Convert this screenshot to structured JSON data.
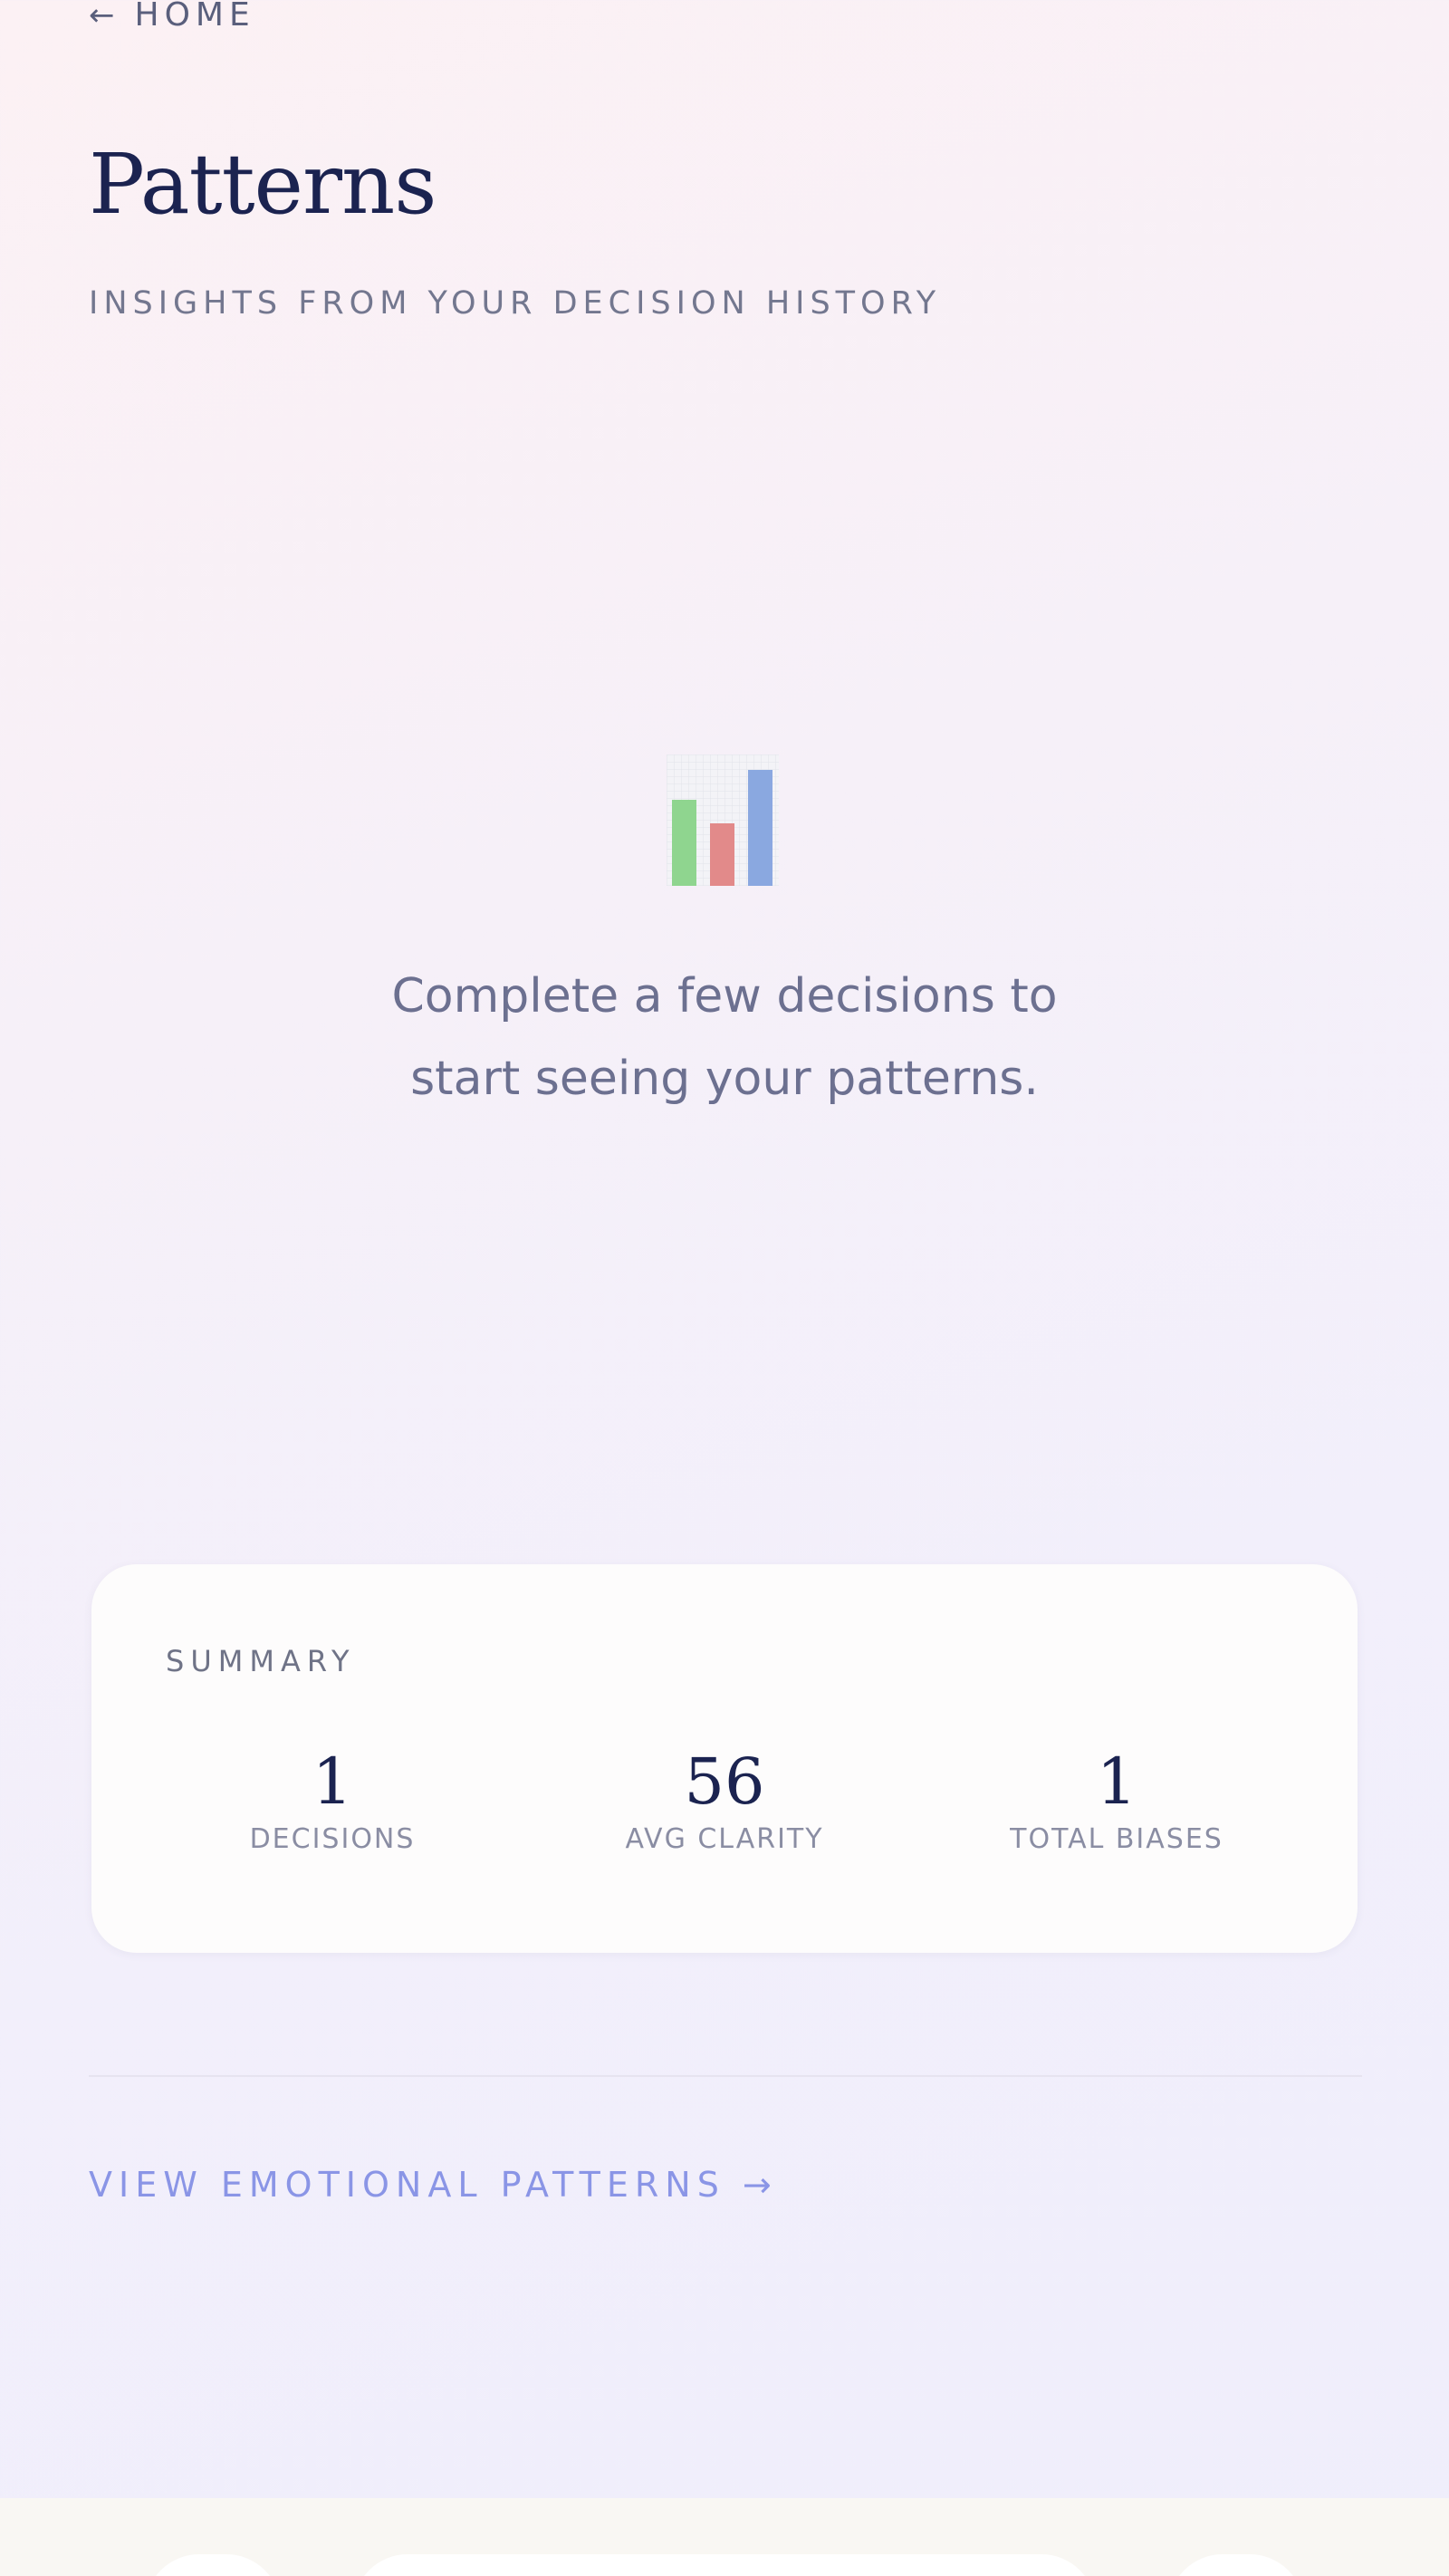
{
  "nav": {
    "back_icon": "←",
    "back_label": "HOME"
  },
  "header": {
    "title": "Patterns",
    "subtitle": "INSIGHTS FROM YOUR DECISION HISTORY"
  },
  "empty_state": {
    "icon": "bar-chart-icon",
    "icon_colors": {
      "bar1": "#8fd58f",
      "bar2": "#e28a8a",
      "bar3": "#8aa8e0"
    },
    "message_line1": "Complete a few decisions to",
    "message_line2": "start seeing your patterns."
  },
  "summary": {
    "label": "SUMMARY",
    "stats": [
      {
        "value": "1",
        "label": "DECISIONS"
      },
      {
        "value": "56",
        "label": "AVG CLARITY"
      },
      {
        "value": "1",
        "label": "TOTAL BIASES"
      }
    ]
  },
  "links": {
    "emotional_patterns": "VIEW EMOTIONAL PATTERNS →"
  },
  "colors": {
    "title": "#1b2350",
    "accent_link": "#8a95e6",
    "card_background": "#fdfcfc"
  }
}
